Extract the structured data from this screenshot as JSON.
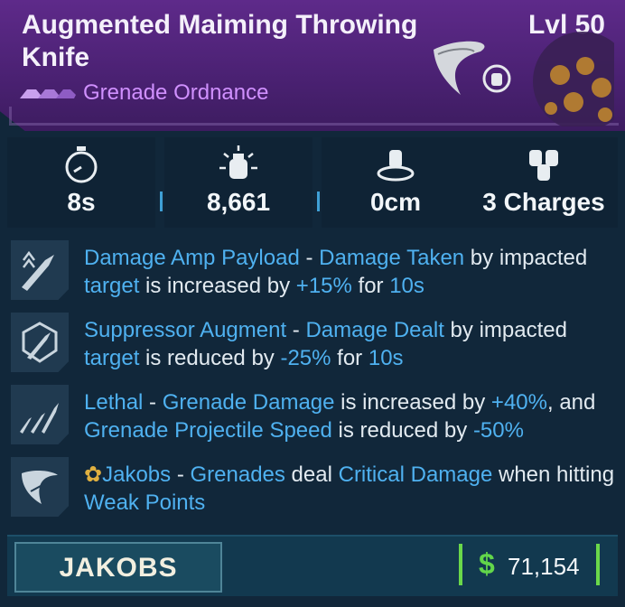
{
  "item": {
    "title": "Augmented Maiming Throwing Knife",
    "level": "Lvl 50",
    "type_label": "Grenade Ordnance",
    "rarity_color": "#d090ff",
    "header_color": "#4a2172"
  },
  "stats": [
    {
      "icon": "stopwatch-icon",
      "value": "8s"
    },
    {
      "icon": "damage-icon",
      "value": "8,661"
    },
    {
      "icon": "radius-icon",
      "value": "0cm"
    },
    {
      "icon": "charges-icon",
      "value": "3 Charges"
    }
  ],
  "perks": [
    {
      "icon": "knife-payload-icon",
      "segments": [
        {
          "t": "Damage Amp Payload",
          "h": true
        },
        {
          "t": " - ",
          "h": false
        },
        {
          "t": "Damage Taken",
          "h": true
        },
        {
          "t": " by impacted ",
          "h": false
        },
        {
          "t": "target",
          "h": true
        },
        {
          "t": " is increased by ",
          "h": false
        },
        {
          "t": "+15%",
          "h": true
        },
        {
          "t": " for ",
          "h": false
        },
        {
          "t": "10s",
          "h": true
        }
      ]
    },
    {
      "icon": "suppressor-augment-icon",
      "segments": [
        {
          "t": "Suppressor Augment",
          "h": true
        },
        {
          "t": " - ",
          "h": false
        },
        {
          "t": "Damage Dealt",
          "h": true
        },
        {
          "t": " by impacted ",
          "h": false
        },
        {
          "t": "target",
          "h": true
        },
        {
          "t": " is reduced by ",
          "h": false
        },
        {
          "t": "-25%",
          "h": true
        },
        {
          "t": " for ",
          "h": false
        },
        {
          "t": "10s",
          "h": true
        }
      ]
    },
    {
      "icon": "lethal-knives-icon",
      "segments": [
        {
          "t": "Lethal",
          "h": true
        },
        {
          "t": " - ",
          "h": false
        },
        {
          "t": "Grenade Damage",
          "h": true
        },
        {
          "t": " is increased by ",
          "h": false
        },
        {
          "t": "+40%",
          "h": true
        },
        {
          "t": ", and ",
          "h": false
        },
        {
          "t": "Grenade Projectile Speed",
          "h": true
        },
        {
          "t": " is reduced by ",
          "h": false
        },
        {
          "t": "-50%",
          "h": true
        }
      ]
    },
    {
      "icon": "jakobs-knife-icon",
      "segments": [
        {
          "t": "Jakobs",
          "h": true
        },
        {
          "t": " - ",
          "h": false
        },
        {
          "t": "Grenades",
          "h": true
        },
        {
          "t": " deal ",
          "h": false
        },
        {
          "t": "Critical Damage",
          "h": true
        },
        {
          "t": " when hitting ",
          "h": false
        },
        {
          "t": "Weak Points",
          "h": true
        }
      ]
    }
  ],
  "footer": {
    "manufacturer": "JAKOBS",
    "currency_symbol": "$",
    "price": "71,154"
  },
  "colors": {
    "highlight": "#4fb1f0",
    "money": "#62d64a"
  }
}
